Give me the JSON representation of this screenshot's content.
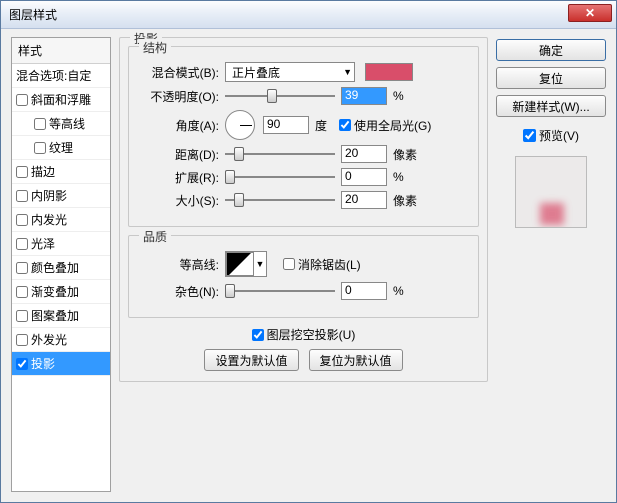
{
  "title": "图层样式",
  "sidebar": {
    "header": "样式",
    "blend_opts": "混合选项:自定",
    "items": [
      {
        "label": "斜面和浮雕",
        "checked": false
      },
      {
        "label": "等高线",
        "checked": false,
        "indent": true
      },
      {
        "label": "纹理",
        "checked": false,
        "indent": true
      },
      {
        "label": "描边",
        "checked": false
      },
      {
        "label": "内阴影",
        "checked": false
      },
      {
        "label": "内发光",
        "checked": false
      },
      {
        "label": "光泽",
        "checked": false
      },
      {
        "label": "颜色叠加",
        "checked": false
      },
      {
        "label": "渐变叠加",
        "checked": false
      },
      {
        "label": "图案叠加",
        "checked": false
      },
      {
        "label": "外发光",
        "checked": false
      },
      {
        "label": "投影",
        "checked": true,
        "selected": true
      }
    ]
  },
  "main": {
    "group_title": "投影",
    "structure": {
      "legend": "结构",
      "blend_mode_label": "混合模式(B):",
      "blend_mode_value": "正片叠底",
      "opacity_label": "不透明度(O):",
      "opacity_value": "39",
      "opacity_unit": "%",
      "angle_label": "角度(A):",
      "angle_value": "90",
      "angle_unit": "度",
      "global_light_label": "使用全局光(G)",
      "distance_label": "距离(D):",
      "distance_value": "20",
      "distance_unit": "像素",
      "spread_label": "扩展(R):",
      "spread_value": "0",
      "spread_unit": "%",
      "size_label": "大小(S):",
      "size_value": "20",
      "size_unit": "像素"
    },
    "quality": {
      "legend": "品质",
      "contour_label": "等高线:",
      "antialias_label": "消除锯齿(L)",
      "noise_label": "杂色(N):",
      "noise_value": "0",
      "noise_unit": "%"
    },
    "knockout_label": "图层挖空投影(U)",
    "set_default": "设置为默认值",
    "reset_default": "复位为默认值"
  },
  "right": {
    "ok": "确定",
    "cancel": "复位",
    "new_style": "新建样式(W)...",
    "preview_label": "预览(V)"
  }
}
